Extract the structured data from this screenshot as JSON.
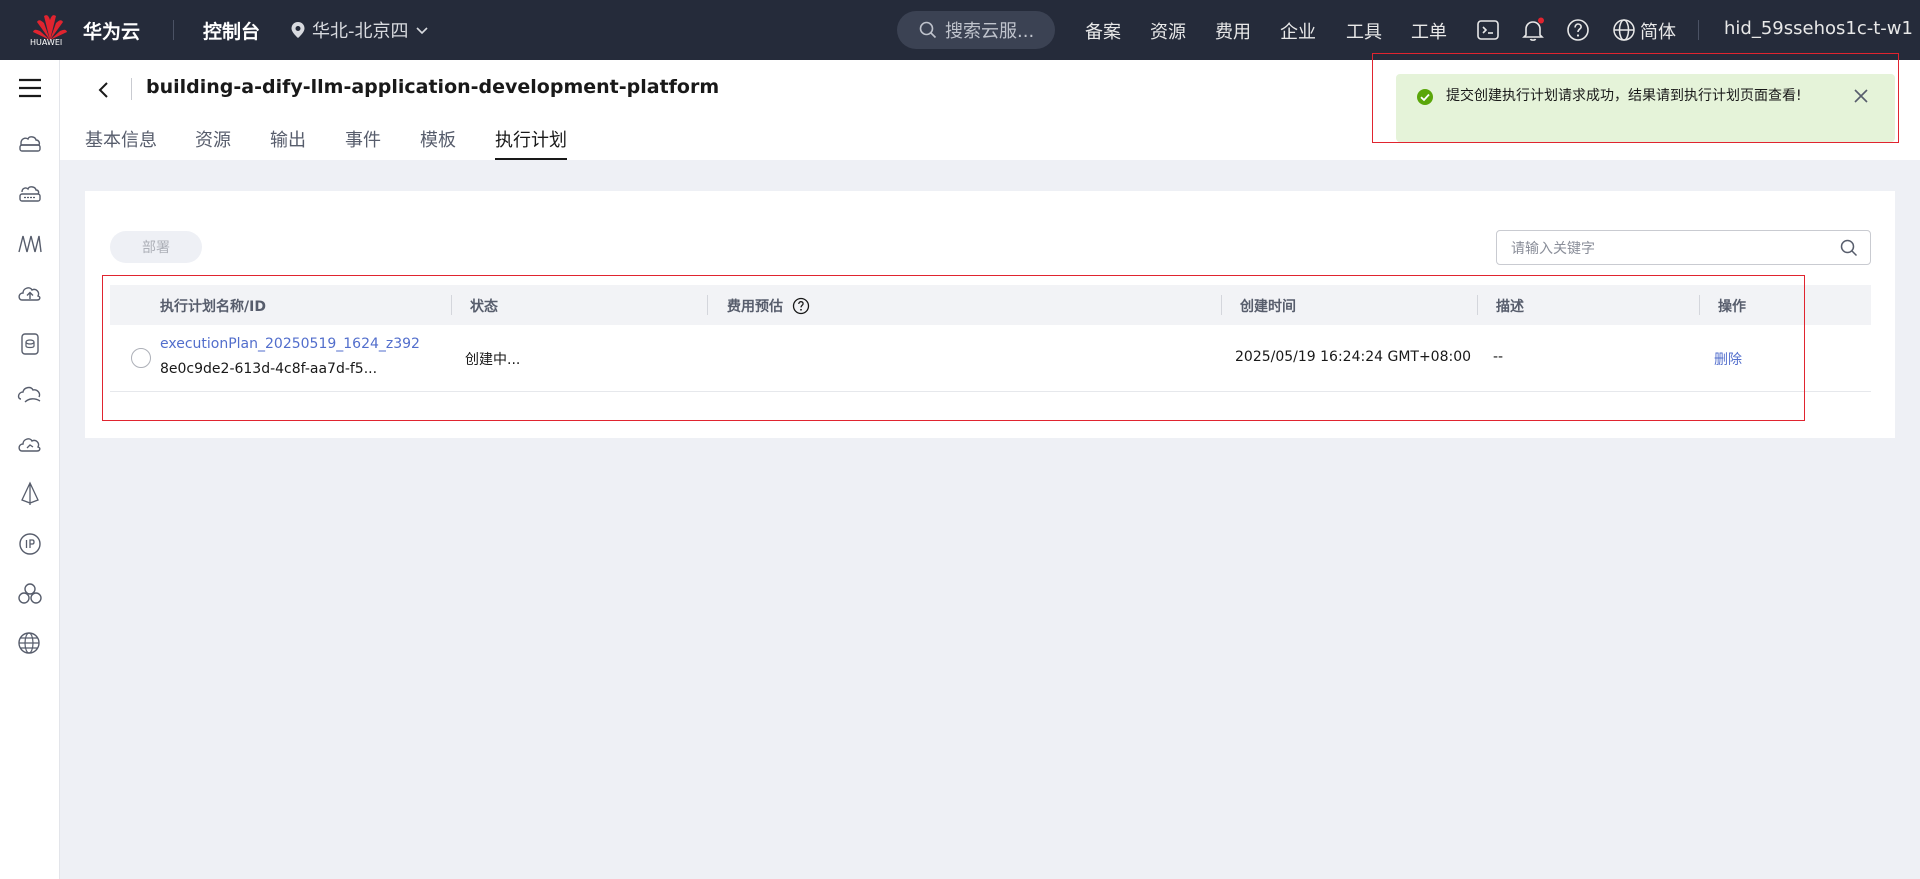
{
  "topbar": {
    "logo_text": "HUAWEI",
    "brand": "华为云",
    "console": "控制台",
    "region": "华北-北京四",
    "search_placeholder": "搜索云服...",
    "nav": [
      "备案",
      "资源",
      "费用",
      "企业",
      "工具",
      "工单"
    ],
    "language": "简体",
    "username": "hid_59ssehos1c-t-w1",
    "notification_dot_color": "#e0242f"
  },
  "sidebar": {
    "icons": [
      "menu-icon",
      "cloud-server-icon",
      "storage-icon",
      "network-icon",
      "cloud-upload-icon",
      "database-icon",
      "cloud-sync-icon",
      "cloud-monitor-icon",
      "ai-icon",
      "ip-icon",
      "cluster-icon",
      "web-icon"
    ]
  },
  "header": {
    "title": "building-a-dify-llm-application-development-platform",
    "tabs": [
      {
        "label": "基本信息",
        "active": false
      },
      {
        "label": "资源",
        "active": false
      },
      {
        "label": "输出",
        "active": false
      },
      {
        "label": "事件",
        "active": false
      },
      {
        "label": "模板",
        "active": false
      },
      {
        "label": "执行计划",
        "active": true
      }
    ]
  },
  "toolbar": {
    "deploy_label": "部署",
    "search_placeholder": "请输入关键字"
  },
  "table": {
    "columns": [
      "执行计划名称/ID",
      "状态",
      "费用预估",
      "创建时间",
      "描述",
      "操作"
    ],
    "rows": [
      {
        "name": "executionPlan_20250519_1624_z392",
        "id": "8e0c9de2-613d-4c8f-aa7d-f5...",
        "status": "创建中...",
        "cost": "",
        "created": "2025/05/19 16:24:24 GMT+08:00",
        "description": "--",
        "action": "删除"
      }
    ]
  },
  "toast": {
    "message": "提交创建执行计划请求成功，结果请到执行计划页面查看!",
    "type": "success"
  },
  "colors": {
    "topbar": "#252b3a",
    "link": "#526ecc",
    "highlight": "#e0242f",
    "toast_bg": "#e5f3d9",
    "success": "#5aa60a"
  }
}
